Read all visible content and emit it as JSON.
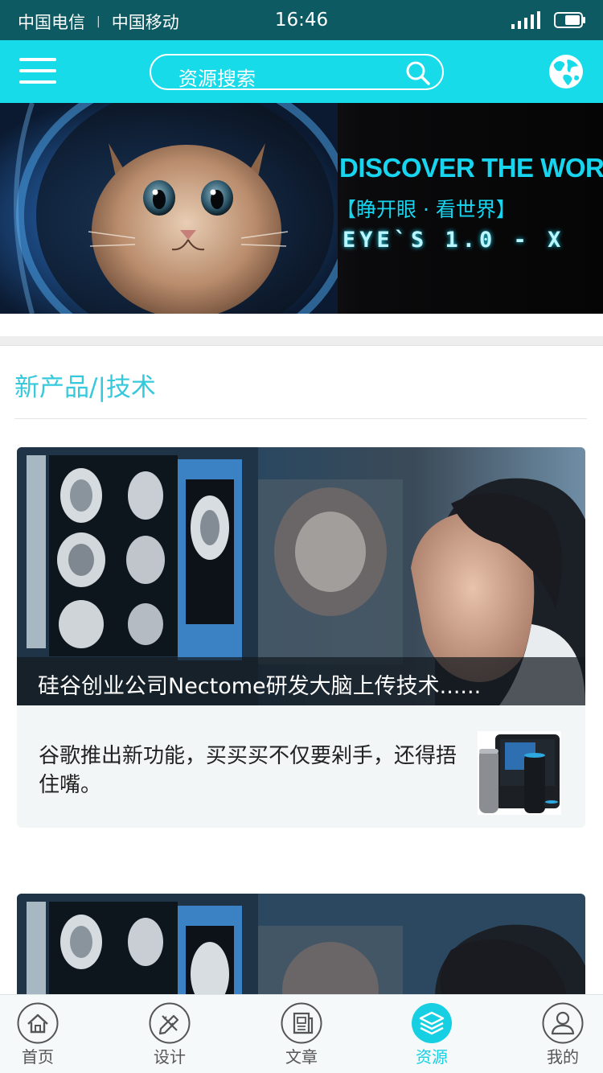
{
  "status_bar": {
    "carrier_1": "中国电信",
    "separator": "|",
    "carrier_2": "中国移动",
    "time": "16:46"
  },
  "header": {
    "menu_icon": "hamburger-menu-icon",
    "search_placeholder": "资源搜索",
    "search_icon": "search-icon",
    "globe_icon": "globe-icon"
  },
  "banner": {
    "title": "DISCOVER THE WORLD",
    "subtitle": "【睁开眼 · 看世界】",
    "version": "EYE`S 1.0 - X"
  },
  "section": {
    "title": "新产品/|技术"
  },
  "articles": [
    {
      "caption": "硅谷创业公司Nectome研发大脑上传技术......",
      "summary": "谷歌推出新功能，买买买不仅要剁手，还得捂住嘴。"
    }
  ],
  "tabs": [
    {
      "label": "首页",
      "icon": "home-icon",
      "active": false
    },
    {
      "label": "设计",
      "icon": "pencil-ruler-icon",
      "active": false
    },
    {
      "label": "文章",
      "icon": "newspaper-icon",
      "active": false
    },
    {
      "label": "资源",
      "icon": "layers-icon",
      "active": true
    },
    {
      "label": "我的",
      "icon": "user-icon",
      "active": false
    }
  ],
  "colors": {
    "status_bar": "#0d5a63",
    "header": "#17dbe8",
    "accent": "#36c9dc",
    "active_tab": "#17cfe3"
  }
}
